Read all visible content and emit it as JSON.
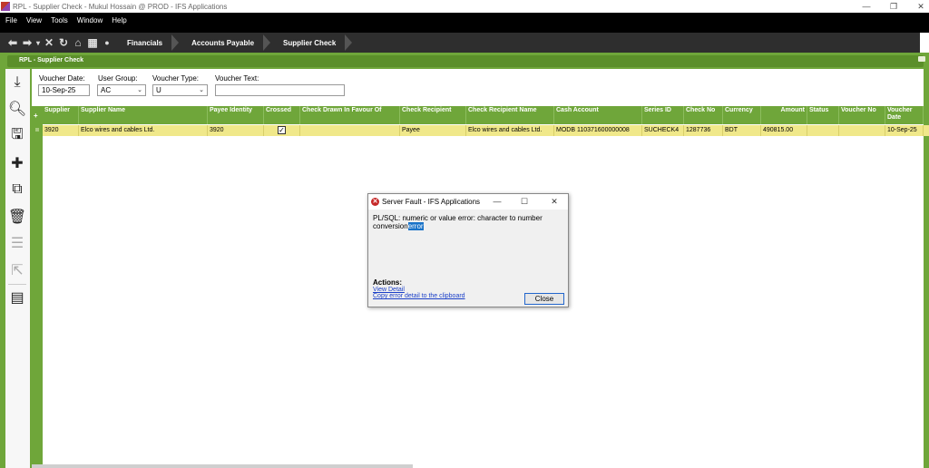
{
  "window": {
    "title": "RPL - Supplier Check - Mukul Hossain @ PROD - IFS Applications",
    "controls": [
      "—",
      "❐",
      "✕"
    ]
  },
  "menu": [
    "File",
    "View",
    "Tools",
    "Window",
    "Help"
  ],
  "breadcrumbs": [
    "Financials",
    "Accounts Payable",
    "Supplier Check"
  ],
  "form_title": "RPL - Supplier Check",
  "search": {
    "voucher_date_label": "Voucher Date:",
    "voucher_date_value": "10-Sep-25",
    "user_group_label": "User Group:",
    "user_group_value": "AC",
    "voucher_type_label": "Voucher Type:",
    "voucher_type_value": "U",
    "voucher_text_label": "Voucher Text:",
    "voucher_text_value": ""
  },
  "grid": {
    "columns": [
      "Supplier",
      "Supplier Name",
      "Payee Identity",
      "Crossed",
      "Check Drawn In Favour Of",
      "Check Recipient",
      "Check Recipient Name",
      "Cash Account",
      "Series ID",
      "Check No",
      "Currency",
      "Amount",
      "Status",
      "Voucher No",
      "Voucher Date"
    ],
    "row": {
      "supplier": "3920",
      "supplier_name": "Elco wires and cables Ltd.",
      "payee_identity": "3920",
      "crossed": true,
      "check_drawn": "",
      "check_recipient": "Payee",
      "check_recipient_name": "Elco wires and cables Ltd.",
      "cash_account": "MODB 110371600000008",
      "series_id": "SUCHECK4",
      "check_no": "1287736",
      "currency": "BDT",
      "amount": "490815.00",
      "status": "",
      "voucher_no": "",
      "voucher_date": "10-Sep-25"
    }
  },
  "dialog": {
    "title": "Server Fault - IFS Applications",
    "message_main": "PL/SQL: numeric or value error: character to number conversion",
    "message_selected": "error",
    "actions_label": "Actions:",
    "view_detail": "View Detail",
    "copy_detail": "Copy error detail to the clipboard",
    "close_button": "Close"
  },
  "colors": {
    "accent_green": "#6fa63a",
    "row_highlight": "#f0e88a",
    "dialog_error": "#c62828"
  }
}
